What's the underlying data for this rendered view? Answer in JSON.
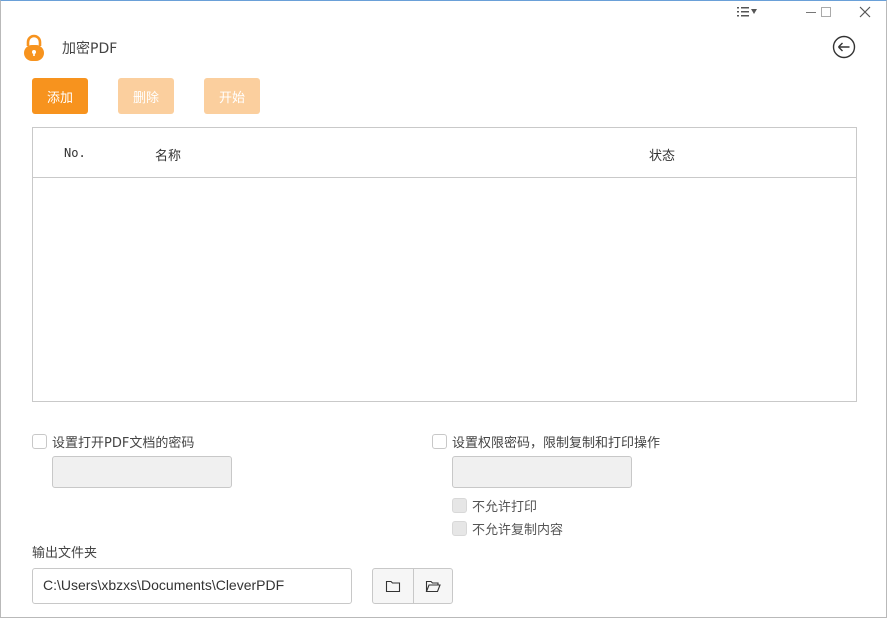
{
  "window": {
    "menu_icon": "list-menu-icon",
    "minimize_icon": "minimize-icon",
    "maximize_icon": "maximize-icon",
    "close_icon": "close-icon"
  },
  "header": {
    "app_icon": "padlock-icon",
    "title": "加密PDF",
    "back_icon": "back-arrow-icon"
  },
  "toolbar": {
    "add_label": "添加",
    "delete_label": "删除",
    "start_label": "开始"
  },
  "colors": {
    "accent": "#f7931e",
    "accent_disabled": "#fbcf9e"
  },
  "table": {
    "columns": [
      "No.",
      "名称",
      "状态"
    ],
    "rows": []
  },
  "options": {
    "open_password": {
      "label": "设置打开PDF文档的密码",
      "checked": false,
      "value": ""
    },
    "permission_password": {
      "label": "设置权限密码，限制复制和打印操作",
      "checked": false,
      "value": ""
    },
    "no_print": {
      "label": "不允许打印",
      "checked": false
    },
    "no_copy": {
      "label": "不允许复制内容",
      "checked": false
    }
  },
  "output": {
    "label": "输出文件夹",
    "path": "C:\\Users\\xbzxs\\Documents\\CleverPDF",
    "browse_icon": "folder-icon",
    "open_icon": "folder-open-icon"
  }
}
